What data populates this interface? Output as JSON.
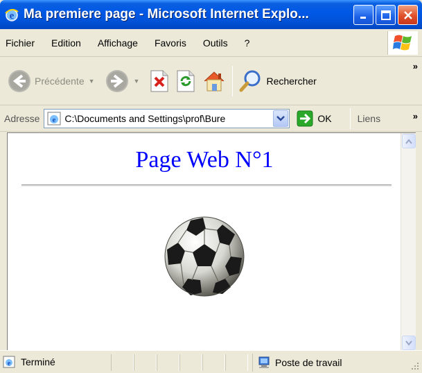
{
  "window": {
    "title": "Ma premiere page - Microsoft Internet Explo..."
  },
  "menu": {
    "items": [
      "Fichier",
      "Edition",
      "Affichage",
      "Favoris",
      "Outils",
      "?"
    ]
  },
  "toolbar": {
    "back_label": "Précédente",
    "search_label": "Rechercher",
    "overflow": "»"
  },
  "address": {
    "label": "Adresse",
    "value": "C:\\Documents and Settings\\prof\\Bure",
    "go_label": "OK",
    "links_label": "Liens",
    "links_overflow": "»"
  },
  "page": {
    "heading": "Page Web N°1",
    "heading_color": "#0000ff"
  },
  "status": {
    "text": "Terminé",
    "zone": "Poste de travail"
  }
}
